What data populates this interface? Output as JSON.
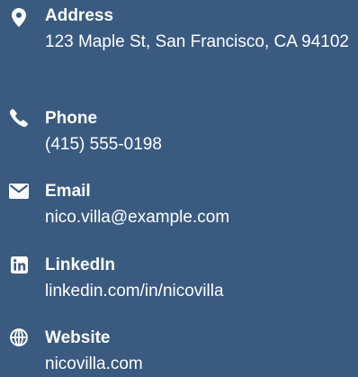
{
  "contact": {
    "address": {
      "icon": "map-marker-icon",
      "label": "Address",
      "value": "123 Maple St, San Francisco, CA 94102"
    },
    "phone": {
      "icon": "phone-icon",
      "label": "Phone",
      "value": "(415) 555-0198"
    },
    "email": {
      "icon": "envelope-icon",
      "label": "Email",
      "value": "nico.villa@example.com"
    },
    "linkedin": {
      "icon": "linkedin-icon",
      "label": "LinkedIn",
      "value": "linkedin.com/in/nicovilla"
    },
    "website": {
      "icon": "globe-icon",
      "label": "Website",
      "value": "nicovilla.com"
    }
  },
  "colors": {
    "background": "#3a5a80",
    "text": "#ffffff"
  }
}
